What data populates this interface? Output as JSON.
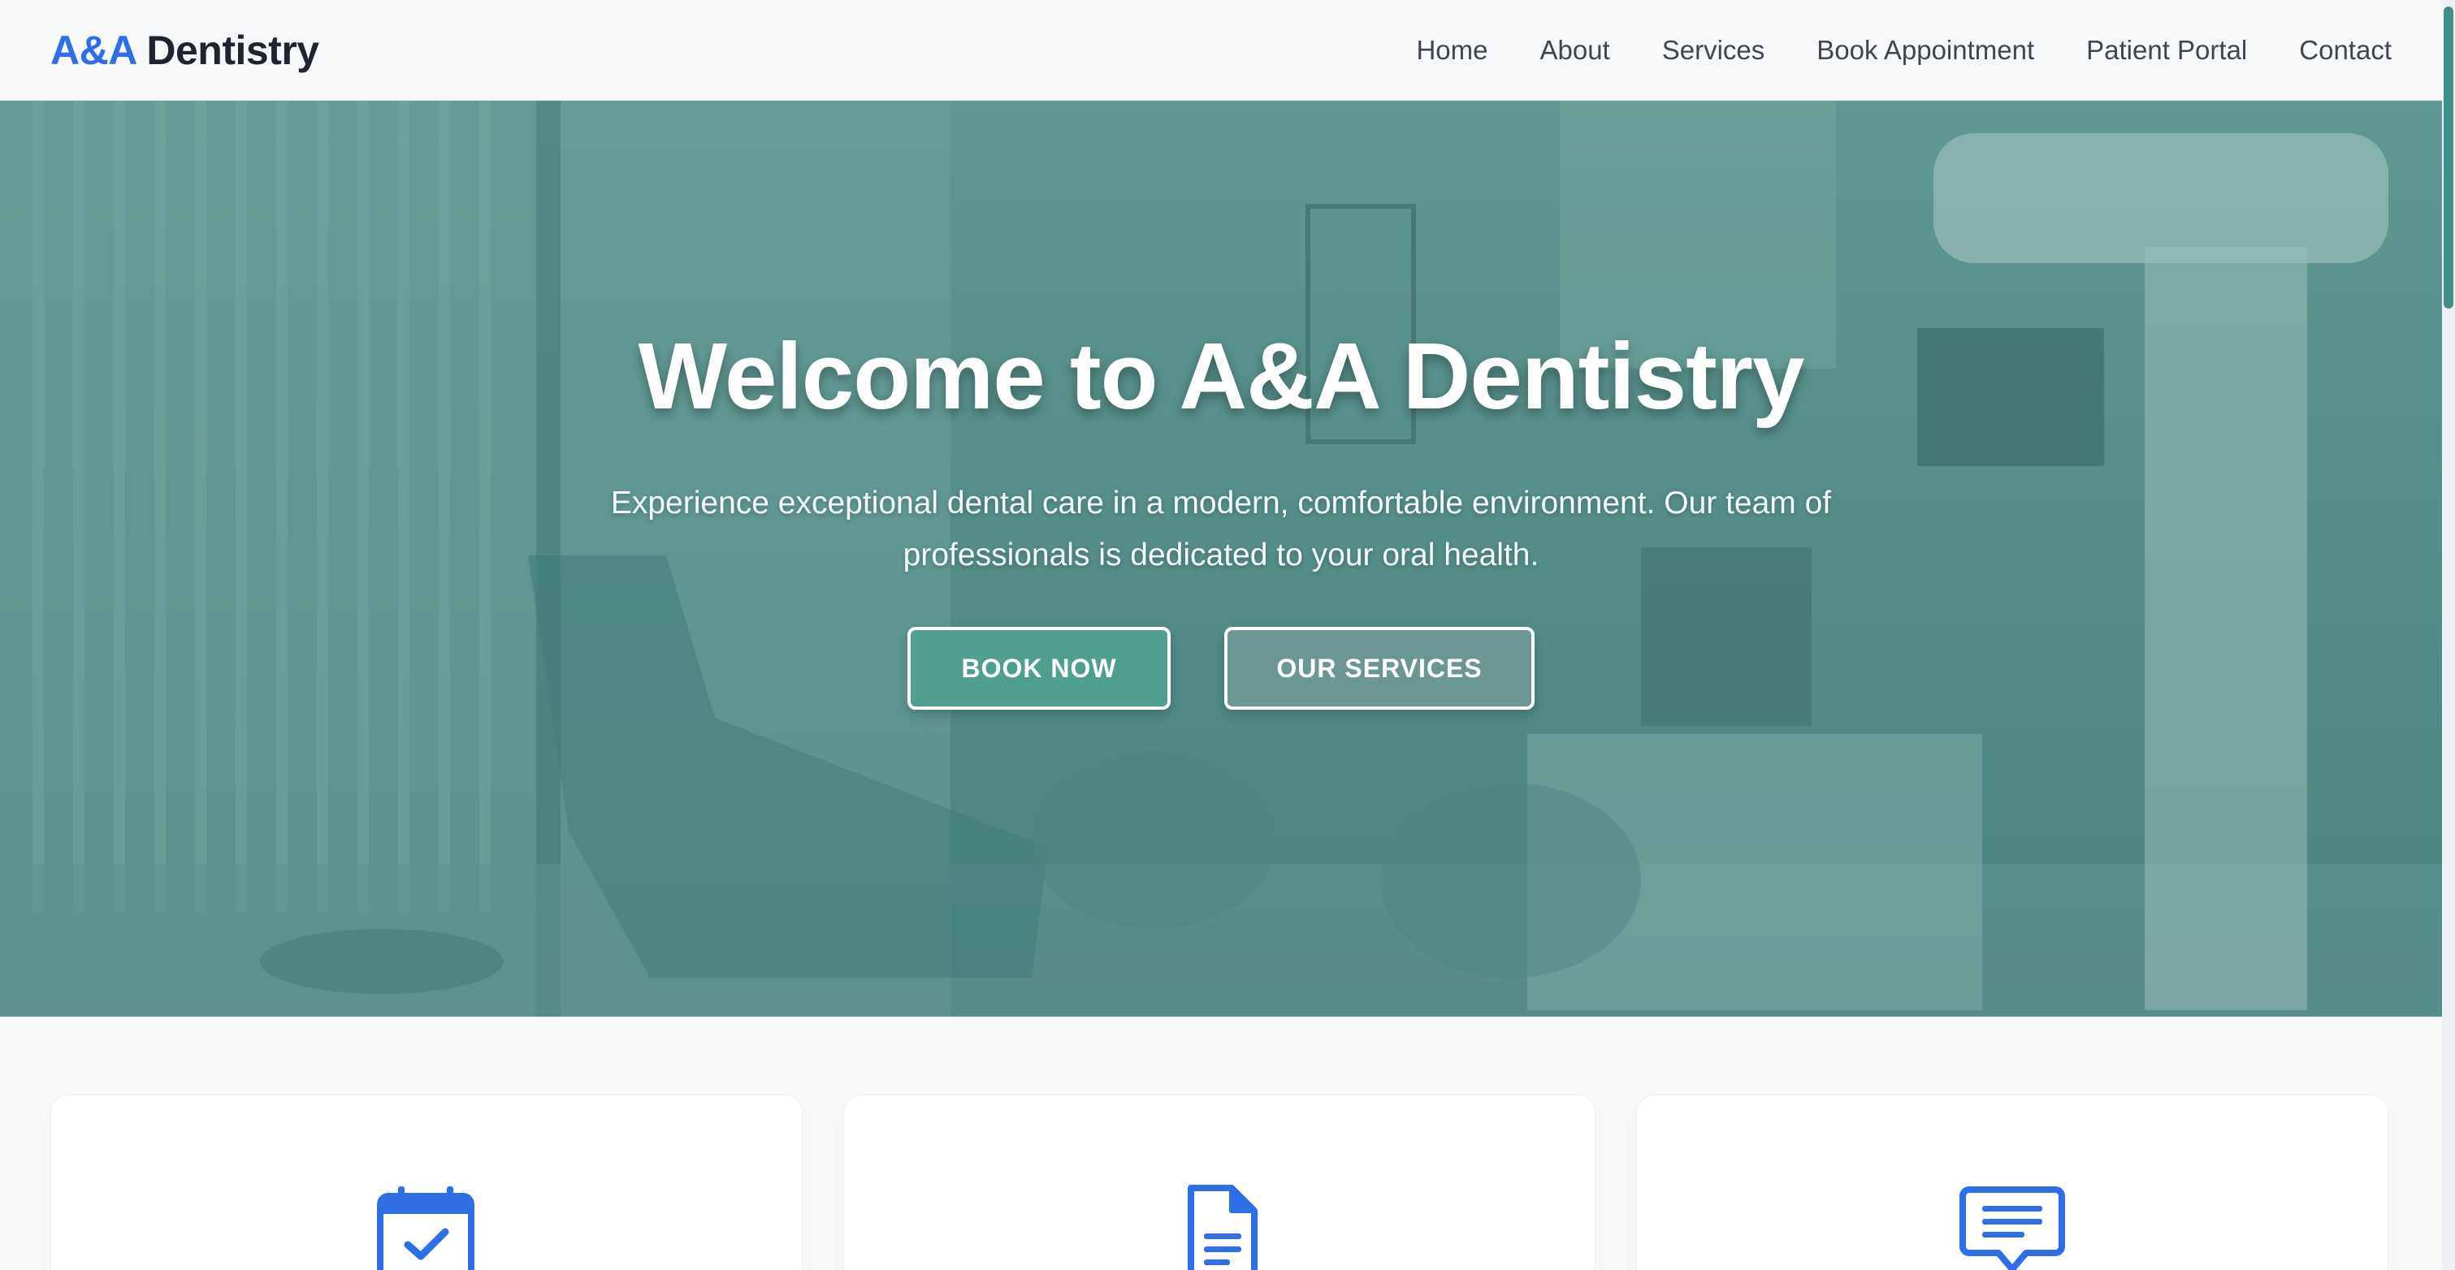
{
  "header": {
    "logo_brand": "A&A",
    "logo_rest": " Dentistry",
    "nav": [
      "Home",
      "About",
      "Services",
      "Book Appointment",
      "Patient Portal",
      "Contact"
    ]
  },
  "hero": {
    "title": "Welcome to A&A Dentistry",
    "subtitle": "Experience exceptional dental care in a modern, comfortable environment. Our team of professionals is dedicated to your oral health.",
    "primary_button": "BOOK NOW",
    "secondary_button": "OUR SERVICES"
  },
  "cards": [
    {
      "icon": "calendar-check-icon"
    },
    {
      "icon": "document-icon"
    },
    {
      "icon": "chat-bubble-icon"
    }
  ],
  "colors": {
    "brand_blue": "#2f6ee6",
    "teal": "#4f9e90",
    "header_bg": "#f6f8f9",
    "page_bg": "#f7f9fb"
  }
}
